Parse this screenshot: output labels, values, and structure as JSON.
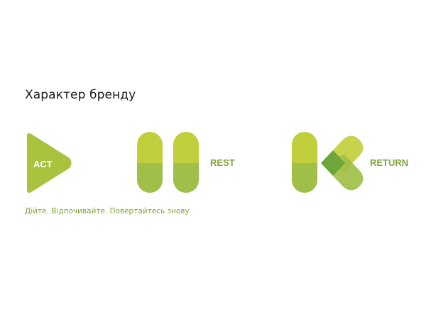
{
  "title": "Характер бренду",
  "marks": {
    "act": {
      "label": "ACT"
    },
    "rest": {
      "label": "REST"
    },
    "return": {
      "label": "RETURN"
    }
  },
  "tagline": "Дійте. Відпочивайте. Повертайтесь знову",
  "colors": {
    "light_green": "#c2cf3c",
    "mid_green": "#a6c246",
    "dark_green": "#8fb540",
    "overlap_green": "#6ea63a",
    "text_green": "#7ea63a"
  }
}
